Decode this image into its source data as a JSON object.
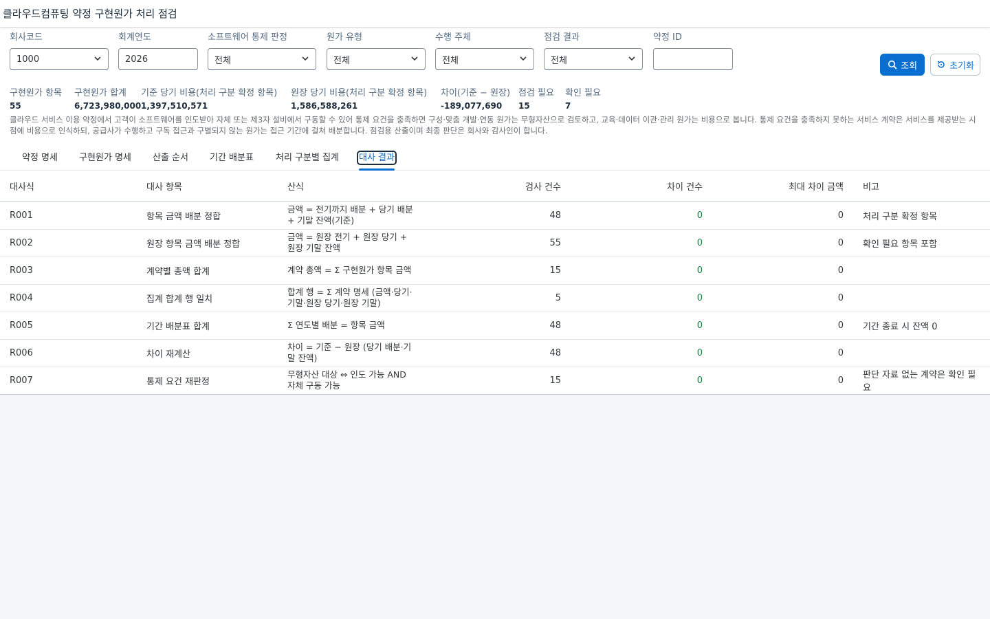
{
  "title": "클라우드컴퓨팅 약정 구현원가 처리 점검",
  "filters": {
    "company_code": {
      "label": "회사코드",
      "value": "1000"
    },
    "fiscal_year": {
      "label": "회계연도",
      "value": "2026"
    },
    "sw_control": {
      "label": "소프트웨어 통제 판정",
      "value": "전체"
    },
    "cost_type": {
      "label": "원가 유형",
      "value": "전체"
    },
    "performer": {
      "label": "수행 주체",
      "value": "전체"
    },
    "check_result": {
      "label": "점검 결과",
      "value": "전체"
    },
    "contract_id": {
      "label": "약정 ID",
      "value": ""
    }
  },
  "actions": {
    "search": "조회",
    "reset": "초기화"
  },
  "kpis": [
    {
      "label": "구현원가 항목",
      "value": "55"
    },
    {
      "label": "구현원가 합계",
      "value": "6,723,980,000"
    },
    {
      "label": "기준 당기 비용(처리 구분 확정 항목)",
      "value": "1,397,510,571"
    },
    {
      "label": "원장 당기 비용(처리 구분 확정 항목)",
      "value": "1,586,588,261"
    },
    {
      "label": "차이(기준 − 원장)",
      "value": "-189,077,690"
    },
    {
      "label": "점검 필요",
      "value": "15"
    },
    {
      "label": "확인 필요",
      "value": "7"
    }
  ],
  "note": "클라우드 서비스 이용 약정에서 고객이 소프트웨어를 인도받아 자체 또는 제3자 설비에서 구동할 수 있어 통제 요건을 충족하면 구성·맞춤 개발·연동 원가는 무형자산으로 검토하고, 교육·데이터 이관·관리 원가는 비용으로 봅니다. 통제 요건을 충족하지 못하는 서비스 계약은 서비스를 제공받는 시점에 비용으로 인식하되, 공급사가 수행하고 구독 접근과 구별되지 않는 원가는 접근 기간에 걸쳐 배분합니다. 점검용 산출이며 최종 판단은 회사와 감사인이 합니다.",
  "tabs": [
    "약정 명세",
    "구현원가 명세",
    "산출 순서",
    "기간 배분표",
    "처리 구분별 집계",
    "대사 결과"
  ],
  "active_tab": 5,
  "table": {
    "headers": [
      "대사식",
      "대사 항목",
      "산식",
      "검사 건수",
      "차이 건수",
      "최대 차이 금액",
      "비고"
    ],
    "rows": [
      {
        "id": "R001",
        "item": "항목 금액 배분 정합",
        "formula": "금액 = 전기까지 배분 + 당기 배분 + 기말 잔액(기준)",
        "checked": "48",
        "diff": "0",
        "max": "0",
        "remark": "처리 구분 확정 항목"
      },
      {
        "id": "R002",
        "item": "원장 항목 금액 배분 정합",
        "formula": "금액 = 원장 전기 + 원장 당기 + 원장 기말 잔액",
        "checked": "55",
        "diff": "0",
        "max": "0",
        "remark": "확인 필요 항목 포함"
      },
      {
        "id": "R003",
        "item": "계약별 총액 합계",
        "formula": "계약 총액 = Σ 구현원가 항목 금액",
        "checked": "15",
        "diff": "0",
        "max": "0",
        "remark": ""
      },
      {
        "id": "R004",
        "item": "집계 합계 행 일치",
        "formula": "합계 행 = Σ 계약 명세 (금액·당기·기말·원장 당기·원장 기말)",
        "checked": "5",
        "diff": "0",
        "max": "0",
        "remark": ""
      },
      {
        "id": "R005",
        "item": "기간 배분표 합계",
        "formula": "Σ 연도별 배분 = 항목 금액",
        "checked": "48",
        "diff": "0",
        "max": "0",
        "remark": "기간 종료 시 잔액 0"
      },
      {
        "id": "R006",
        "item": "차이 재계산",
        "formula": "차이 = 기준 − 원장 (당기 배분·기말 잔액)",
        "checked": "48",
        "diff": "0",
        "max": "0",
        "remark": ""
      },
      {
        "id": "R007",
        "item": "통제 요건 재판정",
        "formula": "무형자산 대상 ⇔ 인도 가능 AND 자체 구동 가능",
        "checked": "15",
        "diff": "0",
        "max": "0",
        "remark": "판단 자료 없는 계약은 확인 필요"
      }
    ]
  }
}
